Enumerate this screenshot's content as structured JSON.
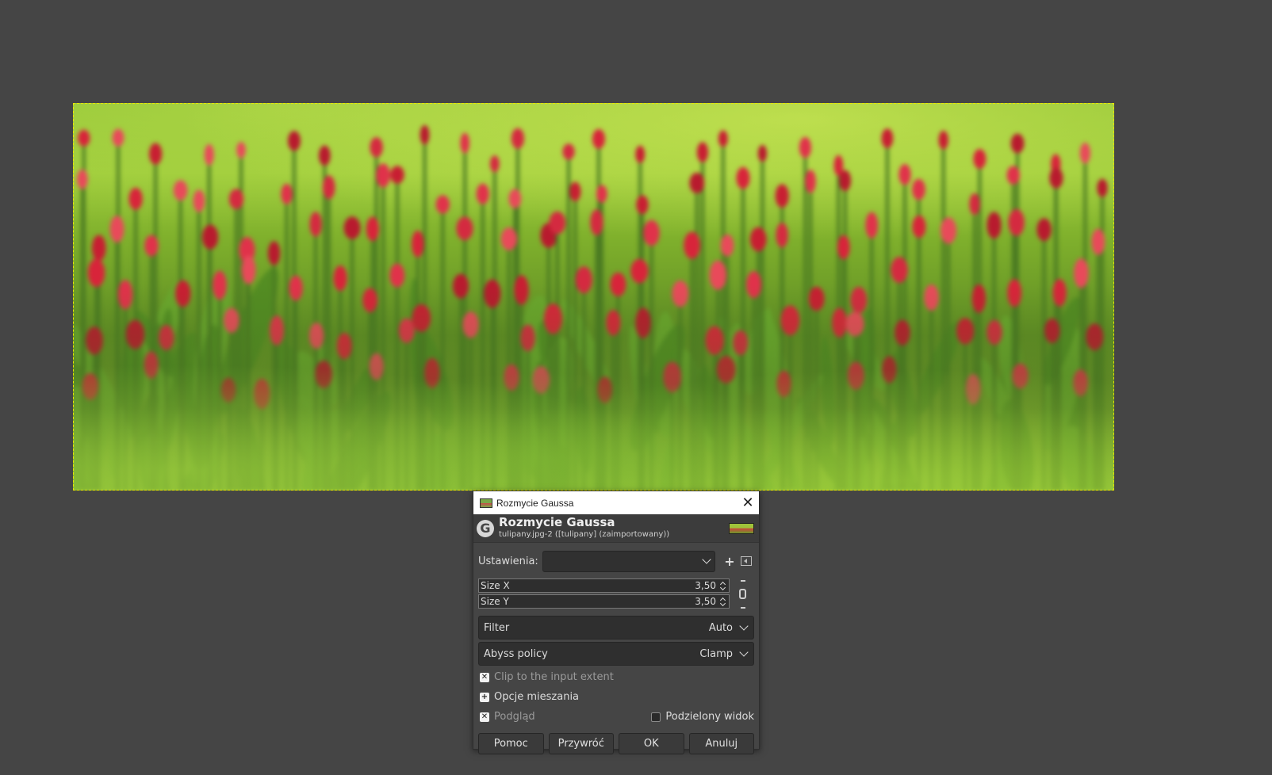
{
  "dialog": {
    "window_title": "Rozmycie Gaussa",
    "header_title": "Rozmycie Gaussa",
    "header_subtitle": "tulipany.jpg-2 ([tulipany] (zaimportowany))",
    "gegl_icon_glyph": "G",
    "presets_label": "Ustawienia:",
    "presets_value": "",
    "add_preset_glyph": "+",
    "size_x": {
      "label": "Size X",
      "value": "3,50"
    },
    "size_y": {
      "label": "Size Y",
      "value": "3,50"
    },
    "filter": {
      "label": "Filter",
      "value": "Auto"
    },
    "abyss": {
      "label": "Abyss policy",
      "value": "Clamp"
    },
    "clip_label": "Clip to the input extent",
    "blend_label": "Opcje mieszania",
    "preview_label": "Podgląd",
    "split_view_label": "Podzielony widok",
    "buttons": {
      "help": "Pomoc",
      "reset": "Przywróć",
      "ok": "OK",
      "cancel": "Anuluj"
    }
  },
  "checks": {
    "clip": "✕",
    "blend": "+",
    "preview": "✕"
  },
  "colors": {
    "canvas_bg": "#454545",
    "selection_border": "#e6e600",
    "tulip_red": "#d8243a"
  },
  "icons": [
    "image-icon",
    "close-icon",
    "gegl-icon",
    "chevron-down-icon",
    "add-icon",
    "menu-left-icon",
    "chain-icon",
    "spin-arrows-icon"
  ]
}
